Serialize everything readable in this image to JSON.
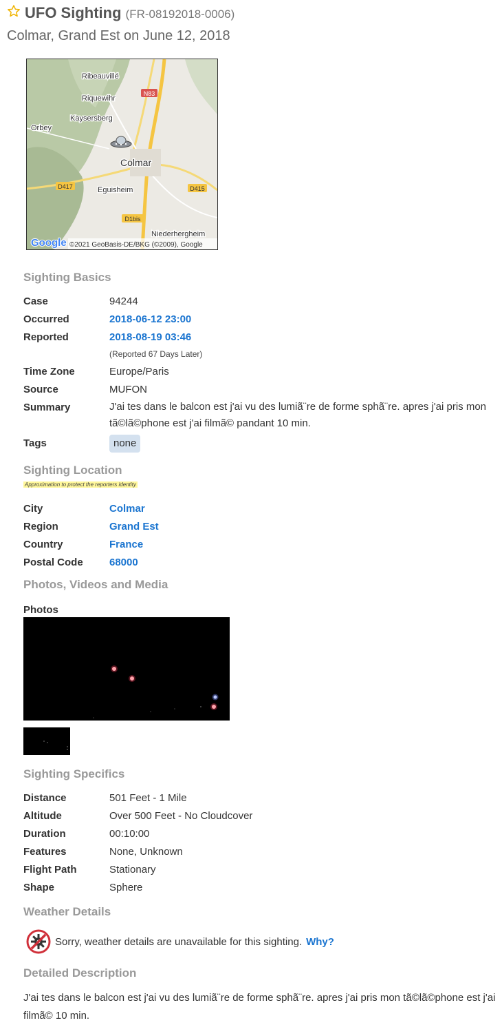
{
  "header": {
    "title": "UFO Sighting",
    "case_id": "(FR-08192018-0006)",
    "subtitle": "Colmar, Grand Est on June 12, 2018"
  },
  "map": {
    "labels": [
      "Ribeauvillé",
      "Riquewihr",
      "Kaysersberg",
      "Orbey",
      "Colmar",
      "Eguisheim",
      "Niederhergheim"
    ],
    "roads": [
      "N83",
      "D417",
      "D415",
      "D1bis"
    ],
    "logo": "Google",
    "attribution": "©2021 GeoBasis-DE/BKG (©2009), Google"
  },
  "basics": {
    "title": "Sighting Basics",
    "case_label": "Case",
    "case_value": "94244",
    "occurred_label": "Occurred",
    "occurred_value": "2018-06-12 23:00",
    "reported_label": "Reported",
    "reported_value": "2018-08-19 03:46",
    "reported_note": "(Reported 67 Days Later)",
    "timezone_label": "Time Zone",
    "timezone_value": "Europe/Paris",
    "source_label": "Source",
    "source_value": "MUFON",
    "summary_label": "Summary",
    "summary_value": "J'ai tes dans le balcon est j'ai vu des lumiã¨re de forme sphã¨re. apres j'ai pris mon tã©lã©phone est j'ai filmã© pandant 10 min.",
    "tags_label": "Tags",
    "tag": "none"
  },
  "location": {
    "title": "Sighting Location",
    "note": "Approximation to protect the reporters identity",
    "city_label": "City",
    "city_value": "Colmar",
    "region_label": "Region",
    "region_value": "Grand Est",
    "country_label": "Country",
    "country_value": "France",
    "postal_label": "Postal Code",
    "postal_value": "68000"
  },
  "media": {
    "title": "Photos, Videos and Media",
    "photos_label": "Photos"
  },
  "specifics": {
    "title": "Sighting Specifics",
    "distance_label": "Distance",
    "distance_value": "501 Feet - 1 Mile",
    "altitude_label": "Altitude",
    "altitude_value": "Over 500 Feet - No Cloudcover",
    "duration_label": "Duration",
    "duration_value": "00:10:00",
    "features_label": "Features",
    "features_value": "None, Unknown",
    "flightpath_label": "Flight Path",
    "flightpath_value": "Stationary",
    "shape_label": "Shape",
    "shape_value": "Sphere"
  },
  "weather": {
    "title": "Weather Details",
    "message": "Sorry, weather details are unavailable for this sighting.",
    "why_link": "Why?"
  },
  "description": {
    "title": "Detailed Description",
    "text": "J'ai tes dans le balcon est j'ai vu des lumiã¨re de forme sphã¨re. apres j'ai pris mon tã©lã©phone est j'ai filmã© 10 min."
  },
  "colors": {
    "link": "#1b75d0",
    "star": "#f0b400",
    "section_title": "#999999"
  }
}
